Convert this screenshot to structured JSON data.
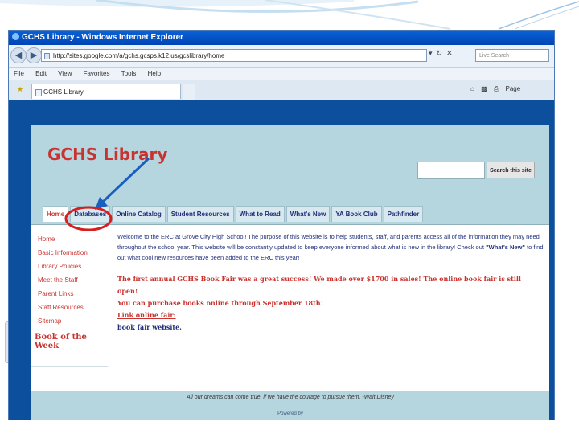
{
  "window": {
    "title": "GCHS Library - Windows Internet Explorer",
    "address": "http://sites.google.com/a/gchs.gcsps.k12.us/gcslibrary/home",
    "live_search_placeholder": "Live Search"
  },
  "menu": [
    "File",
    "Edit",
    "View",
    "Favorites",
    "Tools",
    "Help"
  ],
  "browser_tab": {
    "label": "GCHS Library"
  },
  "command_bar": {
    "page_label": "Page"
  },
  "site": {
    "title": "GCHS Library",
    "search_button": "Search this site",
    "nav_tabs": [
      {
        "label": "Home"
      },
      {
        "label": "Databases"
      },
      {
        "label": "Online Catalog"
      },
      {
        "label": "Student Resources"
      },
      {
        "label": "What to Read"
      },
      {
        "label": "What's New"
      },
      {
        "label": "YA Book Club"
      },
      {
        "label": "Pathfinder"
      }
    ],
    "sidebar": {
      "links": [
        "Home",
        "Basic Information",
        "Library Policies",
        "Meet the Staff",
        "Parent Links",
        "Staff Resources",
        "Sitemap"
      ],
      "feature": "Book of the Week"
    },
    "main": {
      "welcome_1": "Welcome to the ERC at Grove City High School! The purpose of this website is to help students, staff, and parents access all of the information they may need throughout the school year. This website will be constantly updated to keep everyone informed about what is new in the library! Check out",
      "welcome_highlight": "\"What's New\"",
      "welcome_2": "to find out what cool new resources have been added to the ERC this year!",
      "book_fair_1": "The first annual GCHS Book Fair was a great success! We made over $1700 in sales! The online book fair is still open!",
      "book_fair_2": "You can purchase books online through September 18th!",
      "book_fair_link": "Link online fair:",
      "book_fair_3": "book fair website."
    },
    "footer_quote": "All our dreams can come true, if we have the courage to pursue them. -Walt Disney",
    "powered_by": "Powered by"
  },
  "colors": {
    "site_bg": "#b6d6df",
    "accent_red": "#c8332f",
    "link_navy": "#1f2f7a",
    "annotation_blue": "#1a5fc0",
    "annotation_red": "#d42020"
  }
}
